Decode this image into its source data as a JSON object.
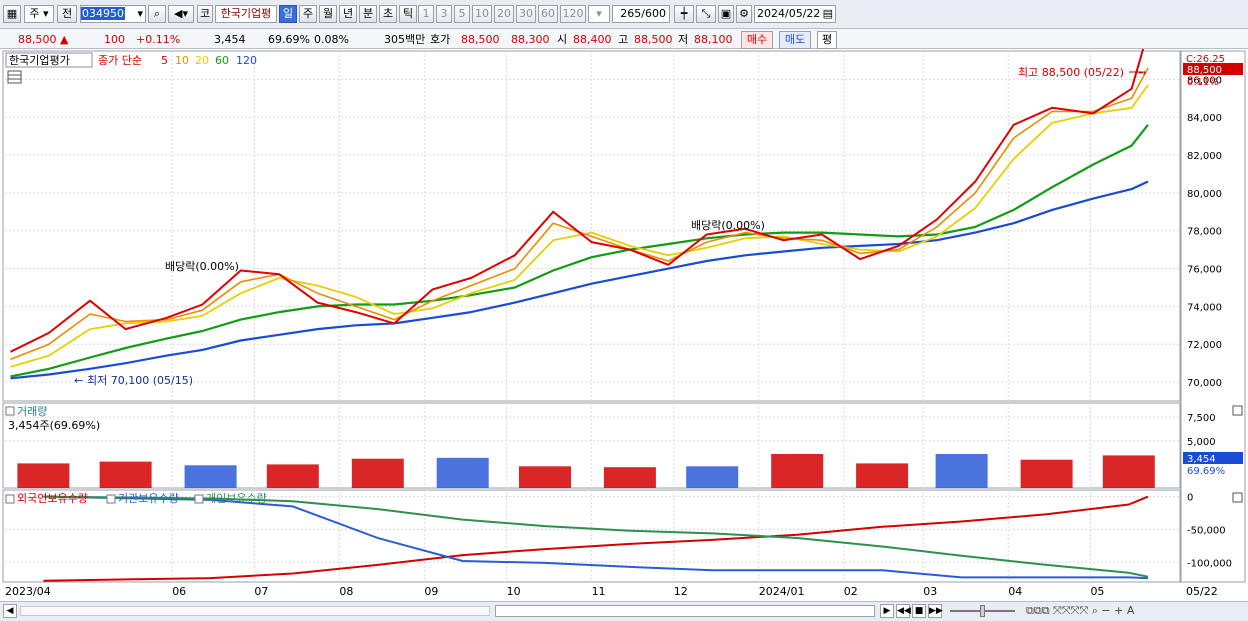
{
  "toolbar": {
    "market_type": "주",
    "prev_label": "전",
    "code": "034950",
    "name_prefix": "코",
    "stock_name": "한국기업평",
    "periods": [
      "일",
      "주",
      "월",
      "년",
      "분",
      "초",
      "틱"
    ],
    "active_period": "일",
    "intervals": [
      "1",
      "3",
      "5",
      "10",
      "20",
      "30",
      "60",
      "120"
    ],
    "count": "265",
    "count_total": "/600",
    "date": "2024/05/22"
  },
  "quote": {
    "price": "88,500",
    "change_mark": "▲",
    "change": "100",
    "change_pct": "+0.11%",
    "volume": "3,454",
    "volume_ratio": "69.69%",
    "turnover": "0.08%",
    "amount": "305백만",
    "bid_label": "호가",
    "ask": "88,500",
    "bid": "88,300",
    "open_label": "시",
    "open": "88,400",
    "high_label": "고",
    "high": "88,500",
    "low_label": "저",
    "low": "88,100",
    "buy_label": "매수",
    "sell_label": "매도",
    "eval_label": "평"
  },
  "price_panel": {
    "legend_name": "한국기업평가",
    "legend_ma_title": "종가 단순",
    "ma_periods": [
      "5",
      "10",
      "20",
      "60",
      "120"
    ],
    "ma_colors": [
      "#e00000",
      "#ee8c00",
      "#e6d000",
      "#139c13",
      "#1a4bd6"
    ],
    "high_annotation": "최고 88,500 (05/22)",
    "low_annotation": "최저 70,100 (05/15)",
    "dividend_1": "배당락(0.00%)",
    "dividend_2": "배당락(0.00%)",
    "corner_label": "C:26.25",
    "last_price_tag": "88,500",
    "last_change_tag": "0.11%"
  },
  "volume_panel": {
    "title": "거래량",
    "current": "3,454주(69.69%)",
    "tag_value": "3,454",
    "tag_pct": "69.69%"
  },
  "holding_panel": {
    "legend": [
      "외국인보유수량",
      "기관보유수량",
      "개인보유수량"
    ],
    "colors": [
      "#d40000",
      "#2a5bd7",
      "#2f8f4e"
    ]
  },
  "x_axis": {
    "labels": [
      "2023/04",
      "06",
      "07",
      "08",
      "09",
      "10",
      "11",
      "12",
      "2024/01",
      "02",
      "03",
      "04",
      "05"
    ],
    "right_label": "05/22"
  },
  "chart_data": [
    {
      "type": "line",
      "title": "한국기업평가",
      "x": [
        "2023-04-03",
        "2023-04-17",
        "2023-05-02",
        "2023-05-15",
        "2023-05-30",
        "2023-06-12",
        "2023-06-26",
        "2023-07-10",
        "2023-07-24",
        "2023-08-07",
        "2023-08-21",
        "2023-09-04",
        "2023-09-18",
        "2023-10-04",
        "2023-10-18",
        "2023-11-01",
        "2023-11-15",
        "2023-11-29",
        "2023-12-13",
        "2023-12-27",
        "2024-01-10",
        "2024-01-24",
        "2024-02-07",
        "2024-02-21",
        "2024-03-06",
        "2024-03-20",
        "2024-04-03",
        "2024-04-17",
        "2024-05-02",
        "2024-05-16",
        "2024-05-22"
      ],
      "series": [
        {
          "name": "5",
          "values": [
            71600,
            72600,
            74300,
            72800,
            73400,
            74100,
            75900,
            75700,
            74200,
            73700,
            73100,
            74900,
            75500,
            76700,
            79000,
            77400,
            77000,
            76200,
            77800,
            78100,
            77500,
            77800,
            76500,
            77200,
            78600,
            80600,
            83600,
            84500,
            84200,
            85500,
            88500
          ]
        },
        {
          "name": "10",
          "values": [
            71200,
            72000,
            73600,
            73200,
            73300,
            73800,
            75300,
            75700,
            74700,
            74000,
            73300,
            74300,
            75100,
            76000,
            78400,
            77700,
            77000,
            76400,
            77400,
            77900,
            77600,
            77500,
            76800,
            77000,
            78200,
            80000,
            82900,
            84300,
            84300,
            85000,
            86600
          ]
        },
        {
          "name": "20",
          "values": [
            70800,
            71400,
            72800,
            73100,
            73200,
            73500,
            74700,
            75500,
            75100,
            74500,
            73600,
            73900,
            74700,
            75400,
            77500,
            77900,
            77200,
            76700,
            77100,
            77600,
            77700,
            77300,
            77000,
            76900,
            77700,
            79200,
            81800,
            83700,
            84200,
            84500,
            85700
          ]
        },
        {
          "name": "60",
          "values": [
            70300,
            70700,
            71300,
            71800,
            72300,
            72700,
            73300,
            73700,
            74000,
            74100,
            74100,
            74300,
            74600,
            75000,
            75900,
            76600,
            77000,
            77300,
            77600,
            77800,
            77900,
            77900,
            77800,
            77700,
            77800,
            78200,
            79100,
            80300,
            81500,
            82500,
            83600
          ]
        },
        {
          "name": "120",
          "values": [
            70200,
            70400,
            70700,
            71000,
            71400,
            71700,
            72200,
            72500,
            72800,
            73000,
            73100,
            73400,
            73700,
            74200,
            74700,
            75200,
            75600,
            76000,
            76400,
            76700,
            76900,
            77100,
            77200,
            77300,
            77500,
            77900,
            78400,
            79100,
            79700,
            80200,
            80600
          ]
        }
      ],
      "ylim": [
        69000,
        87500
      ],
      "y_ticks": [
        70000,
        72000,
        74000,
        76000,
        78000,
        80000,
        82000,
        84000,
        86000
      ],
      "y_tick_labels": [
        "70,000",
        "72,000",
        "74,000",
        "76,000",
        "78,000",
        "80,000",
        "82,000",
        "84,000",
        "86,000"
      ],
      "grid": true,
      "legend": "top-left"
    },
    {
      "type": "bar",
      "title": "거래량",
      "x": [
        "2023-04",
        "2023-05",
        "2023-06",
        "2023-07",
        "2023-08",
        "2023-09",
        "2023-10",
        "2023-11",
        "2023-12",
        "2024-01",
        "2024-02",
        "2024-03",
        "2024-04",
        "2024-05"
      ],
      "values": [
        2600,
        2800,
        2400,
        2500,
        3100,
        3200,
        2300,
        2200,
        2300,
        3600,
        2600,
        3600,
        3000,
        3454
      ],
      "ylim": [
        0,
        9000
      ],
      "y_ticks": [
        5000,
        7500
      ],
      "y_tick_labels": [
        "5,000",
        "7,500"
      ],
      "grid": true
    },
    {
      "type": "line",
      "title": "보유수량",
      "x": [
        "2023-04",
        "2023-06",
        "2023-07",
        "2023-08",
        "2023-09",
        "2023-10",
        "2023-11",
        "2023-12",
        "2024-01",
        "2024-02",
        "2024-03",
        "2024-04",
        "2024-05",
        "2024-05-22"
      ],
      "series": [
        {
          "name": "외국인보유수량",
          "values": [
            -128000,
            -124000,
            -117000,
            -104000,
            -89000,
            -80000,
            -72000,
            -66000,
            -58000,
            -46000,
            -38000,
            -27000,
            -12000,
            0
          ]
        },
        {
          "name": "기관보유수량",
          "values": [
            0,
            -5000,
            -15000,
            -63000,
            -98000,
            -101000,
            -107000,
            -112000,
            -112000,
            -112000,
            -123000,
            -123000,
            -123000,
            -124000
          ]
        },
        {
          "name": "개인보유수량",
          "values": [
            0,
            -3000,
            -7000,
            -19000,
            -35000,
            -45000,
            -52000,
            -56000,
            -63000,
            -76000,
            -90000,
            -104000,
            -116000,
            -122000
          ]
        }
      ],
      "ylim": [
        -130000,
        10000
      ],
      "y_ticks": [
        0,
        -50000,
        -100000
      ],
      "y_tick_labels": [
        "0",
        "-50,000",
        "-100,000"
      ],
      "grid": true,
      "legend": "top-left"
    }
  ]
}
